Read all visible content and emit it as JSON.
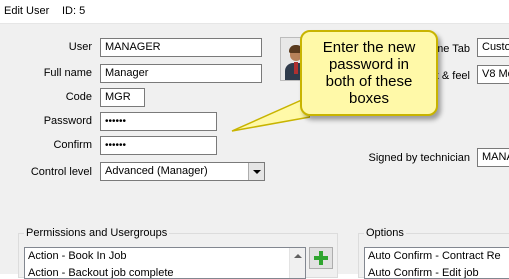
{
  "window": {
    "title": "Edit User",
    "id_label": "ID: 5"
  },
  "fields": {
    "user": {
      "label": "User",
      "value": "MANAGER"
    },
    "full_name": {
      "label": "Full name",
      "value": "Manager"
    },
    "code": {
      "label": "Code",
      "value": "MGR"
    },
    "password": {
      "label": "Password",
      "value": "••••••"
    },
    "confirm": {
      "label": "Confirm",
      "value": "••••••"
    },
    "control_level": {
      "label": "Control level",
      "value": "Advanced (Manager)"
    }
  },
  "right_fields": {
    "home_tab": {
      "label": "me Tab",
      "value": "Custo"
    },
    "look_feel": {
      "label": "k & feel",
      "value": "V8 Mo"
    },
    "signed_by_technician": {
      "label": "Signed by technician",
      "value": "MANA"
    }
  },
  "callout": {
    "text": "Enter the new\npassword in\nboth of these\nboxes"
  },
  "permissions": {
    "title": "Permissions and Usergroups",
    "items": [
      "Action - Book In Job",
      "Action - Backout job complete"
    ]
  },
  "options": {
    "title": "Options",
    "items": [
      "Auto Confirm - Contract Re",
      "Auto Confirm - Edit job"
    ]
  },
  "icons": {
    "user_photo": "user-photo-icon",
    "add": "green-plus-icon",
    "dropdown": "chevron-down-icon",
    "scroll_up": "scroll-up-arrow-icon"
  },
  "colors": {
    "callout_fill": "#fff9a8",
    "callout_border": "#c8b400",
    "plus_green": "#2fa52f"
  }
}
